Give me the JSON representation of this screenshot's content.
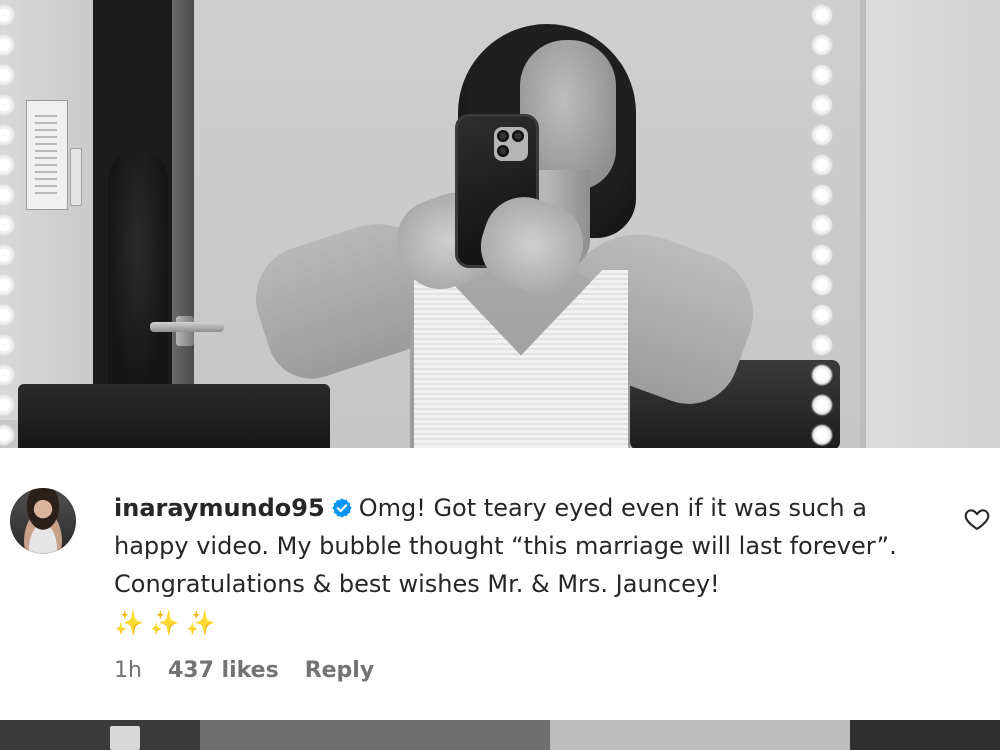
{
  "comment": {
    "username": "inaraymundo95",
    "verified": true,
    "text": "Omg! Got teary eyed even if it was such a happy video. My bubble thought “this marriage will last forever”. Congratulations & best wishes Mr. & Mrs. Jauncey!",
    "emojis": "✨✨✨",
    "time_ago": "1h",
    "likes": "437 likes",
    "reply_label": "Reply"
  },
  "icons": {
    "verified": "verified-badge-icon",
    "like": "heart-outline-icon"
  },
  "colors": {
    "verified_blue": "#0095f6",
    "text_primary": "#262626",
    "text_secondary": "#737373",
    "card_background": "#ffffff"
  }
}
